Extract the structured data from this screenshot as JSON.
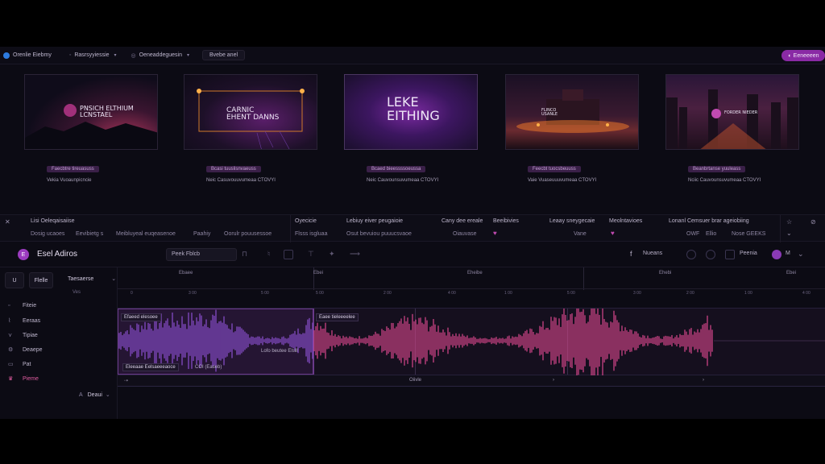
{
  "topbar": {
    "app_name": "Orenlie Eiebmy",
    "menu1": "Rasrsyyiessie",
    "menu2": "Oeneaddeguesin",
    "menu3": "Bvebe anel",
    "right_button": "Eeneeeen"
  },
  "cards": [
    {
      "thumb_title": "PNSICH ELTHIUM\nLCNSTAEL",
      "tag": "Faecbtre tireuasuss",
      "meta": "Vekia Vuoaunpicncie"
    },
    {
      "thumb_title": "CARNIC\nEHENT DANNS",
      "tag": "Bcasi tuuslisnvaeuss",
      "meta": "Neic Casuvouuvumeaa  CTOVYI"
    },
    {
      "thumb_title": "LEKE\nEITHING",
      "tag": "Bcaed bieessssoeussa",
      "meta": "Neic Cauvounsuvumeaa  CTOVYI"
    },
    {
      "thumb_title": "FLINCO\nUSANLE",
      "tag": "Feecbt tuocsbeuuss",
      "meta": "Vaie Vuaseuuuvumeaa  CTOVYI"
    },
    {
      "thumb_title": "FORDER NIEDER",
      "tag": "Beanbrtanse yuuleass",
      "meta": "Nciic Cauvounsuvumeaa  CTOVYI"
    }
  ],
  "strip": {
    "c1_top": "Lisi Oeleqaisaiise",
    "c1_a": "Dosig ucaoes",
    "c1_b": "Eevibietg s",
    "c1_c": "Meibluyeal euqeasenoe",
    "c1_d": "Paahiy",
    "c1_e": "Oorulr pouusessoe",
    "c2_top": "Oyecicie",
    "c2_a": "Flsss isgluaa",
    "c3_top": "Lebiuy eiver peugaioie",
    "c3_a": "Osut bevuiou puuucsvaoe",
    "c4_top": "Cany dee ereale",
    "c4_a": "Oiauvase",
    "c5_top": "Beeibivies",
    "c6_top": "Leaay sneygecaie",
    "c6_a": "Vane",
    "c7_top": "Meolntavioes",
    "c8_top": "Lonanl Cemsuer brar ageiobiing",
    "c8_a": "OWF",
    "c8_b": "Ellio",
    "c8_c": "Nose GEEKS"
  },
  "editor": {
    "logo": "E",
    "title": "Esel Adiros",
    "field": "Peek  Fblcb",
    "right1": "Nueans",
    "right2": "Peenia",
    "right3": "M",
    "left_btn1": "U",
    "left_btn2": "Flelle",
    "left_dropdown": "Taesaerse",
    "left_sub": "Ves",
    "nav": [
      "Fiteie",
      "Eeraas",
      "Tipiae",
      "Deaepe",
      "Pat",
      "Pieme"
    ],
    "bottom_select": "Deaui",
    "ruler": [
      "Ebaee",
      "Ebei",
      "Eheibe",
      "Ehebi",
      "Ebei"
    ],
    "ticks": [
      "0",
      "3 00",
      "5 00",
      "5 00",
      "2 00",
      "4 00",
      "1 00",
      "5 00",
      "3 00",
      "2 00",
      "1 00",
      "4 00"
    ],
    "clip1_label": "Efaeed elesoee",
    "clip2_label": "Eaee tieleeeelee",
    "clip_note": "Lofo beutee Elsill",
    "clip1_bottom": "Eleeaae Eelsaeeeaoce",
    "clip1_bottom2": "COI (Easeb)",
    "scroll_label": "Oiivle"
  },
  "colors": {
    "accent": "#8a2aa5",
    "wave_purple": "#8b4fd0",
    "wave_pink": "#d8478c",
    "background": "#0c0b14"
  }
}
